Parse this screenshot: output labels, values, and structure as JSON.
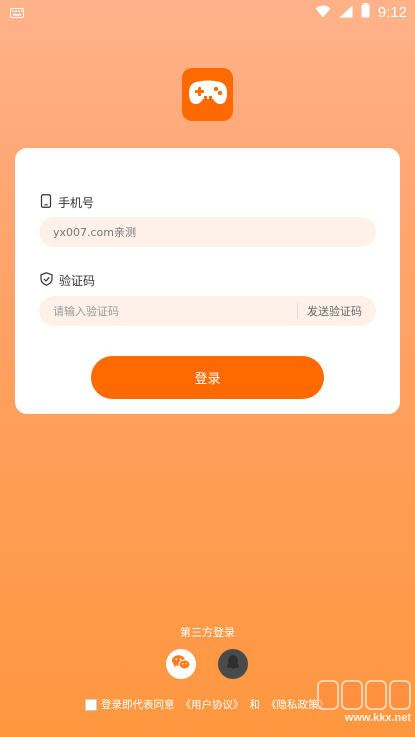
{
  "status_bar": {
    "time": "9:12",
    "icons": [
      "keyboard-icon",
      "wifi-icon",
      "signal-icon",
      "battery-icon"
    ]
  },
  "app": {
    "logo_icon": "gamepad-icon",
    "accent_color": "#ff6a00"
  },
  "login_form": {
    "phone": {
      "label": "手机号",
      "icon": "phone-icon",
      "value": "yx007.com亲测",
      "placeholder": ""
    },
    "code": {
      "label": "验证码",
      "icon": "shield-icon",
      "value": "",
      "placeholder": "请输入验证码",
      "send_label": "发送验证码"
    },
    "submit_label": "登录"
  },
  "third_party": {
    "label": "第三方登录",
    "providers": [
      "wechat-icon",
      "qq-icon"
    ]
  },
  "agreement": {
    "prefix": "登录即代表同意",
    "user_agreement": "《用户协议》",
    "conjunction": "和",
    "privacy_policy": "《隐私政策》"
  },
  "watermark": {
    "url": "www.kkx.net"
  }
}
